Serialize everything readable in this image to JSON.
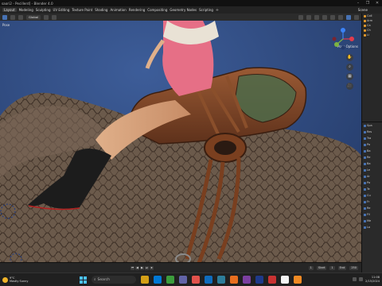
{
  "window": {
    "title": "saori2 - Pecillerd] - Blender 4.0",
    "controls": [
      "–",
      "❐",
      "✕"
    ]
  },
  "menubar": {
    "items": [
      "Layout",
      "Modeling",
      "Sculpting",
      "UV Editing",
      "Texture Paint",
      "Shading",
      "Animation",
      "Rendering",
      "Compositing",
      "Geometry Nodes",
      "Scripting"
    ],
    "active_index": 0,
    "add_tab": "+",
    "scene_label": "Scene"
  },
  "header3d": {
    "mode": "Pose",
    "transform": "Global",
    "pose_options": "Pose Options"
  },
  "viewport": {
    "mode_label": "Pose",
    "background_color": "#2f4e8a"
  },
  "gizmo": {
    "x_color": "#e23b4c",
    "y_color": "#7cb342",
    "z_color": "#3b82f6"
  },
  "navbuttons": [
    "✋",
    "⌕",
    "▦",
    "🎥"
  ],
  "outliner": {
    "rows": [
      "Coll",
      "Arm",
      "Ca",
      "Ch",
      "Li"
    ]
  },
  "properties": {
    "rows": [
      "Spa",
      "Res",
      "Tra",
      "Po",
      "Ba",
      "Re",
      "Ba",
      "Le",
      "Ar",
      "Pa",
      "Te",
      "Cu",
      "Fr",
      "Re",
      "Fil",
      "Me",
      "Lo"
    ]
  },
  "timeline": {
    "playback": [
      "⏮",
      "◀",
      "▶",
      "⏭",
      "⏹"
    ],
    "start_label": "Start",
    "start": "1",
    "end_label": "End",
    "end": "250",
    "current_frame": "1"
  },
  "taskbar": {
    "weather_temp": "9°C",
    "weather_desc": "Mostly Sunny",
    "search_placeholder": "Search",
    "time": "11:08",
    "date": "2/15/2024",
    "app_colors": [
      "#d4a017",
      "#0078d4",
      "#3c9c3c",
      "#6264a7",
      "#e2524c",
      "#0f6cbd",
      "#2d7d9a",
      "#e86e1f",
      "#7b3fa0",
      "#1e3a8a",
      "#c83232",
      "#f5f5f5",
      "#f08a24"
    ]
  }
}
